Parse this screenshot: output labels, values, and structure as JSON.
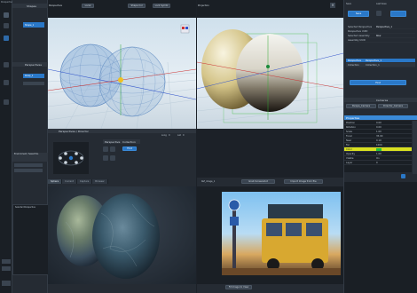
{
  "app": {
    "left_toolbar_label": "Perspective",
    "shapes_label": "Shapes"
  },
  "left_panel": {
    "header": "Shapes",
    "item_label": "Shape_1",
    "perspectives_header": "Perspectives",
    "perspective_item": "Persp_1",
    "env_label": "Environment / Saved Pos",
    "selected_label": "Selected Perspective"
  },
  "viewport_left": {
    "tab": "Perspective",
    "mode": "Local",
    "shape_field": "Shape Col",
    "persp_field": "Lock Symbl"
  },
  "viewport_right": {
    "tab": "Projection"
  },
  "director": {
    "header": "Perspectives / Director",
    "long_label": "Long",
    "lat_label": "Lat",
    "long_value": "0",
    "lat_value": "0",
    "sub_header": "Perspective",
    "collection_label": "Collection",
    "first_label": "First"
  },
  "bottom_left": {
    "tabs": [
      "Sphere",
      "Current",
      "Capture",
      "Browser"
    ]
  },
  "bottom_right": {
    "file_label": "Ref_image_1",
    "grab_label": "Grab Screenshot",
    "import_label": "Import Image from file",
    "zoom_label": "Fit Image to View"
  },
  "right_panel": {
    "save_label": "Save",
    "last_save_label": "Last Save",
    "save_btn": "Save",
    "fields": [
      {
        "label": "Selected Perspective",
        "value": "Perspective_1"
      },
      {
        "label": "Perspective UUID",
        "value": "b04c9271-0935-4e4c-8f95-a7f82e3c1d50"
      },
      {
        "label": "Selected Assembly",
        "value": "Row"
      },
      {
        "label": "Assembly UUID",
        "value": "0a5c1f83-b046-4dc6-a94c-a9785c0b12ff"
      }
    ],
    "persp_label": "Perspective",
    "persp_value": "Perspective_1",
    "collection_label": "Collection",
    "collection_value": "Collection_1",
    "first_btn": "First",
    "camera_header": "Cameras",
    "camera_items": [
      "Perspe_Camera",
      "Director_Camera"
    ],
    "properties_header": "Properties",
    "property_rows": [
      {
        "label": "Position",
        "value": "0.00"
      },
      {
        "label": "Rotation",
        "value": "0.00"
      },
      {
        "label": "Scale",
        "value": "1.00"
      },
      {
        "label": "Focal",
        "value": "35.00"
      },
      {
        "label": "Near",
        "value": "0.10"
      },
      {
        "label": "Far",
        "value": "1000"
      },
      {
        "label": "Color",
        "value": ""
      },
      {
        "label": "Opacity",
        "value": "1.00"
      },
      {
        "label": "Visible",
        "value": "On"
      },
      {
        "label": "Layer",
        "value": "0"
      }
    ],
    "colors": {
      "accent": "#2a78c8",
      "highlight": "#3a8ad8",
      "selected_swatch": "#d8e020"
    }
  }
}
